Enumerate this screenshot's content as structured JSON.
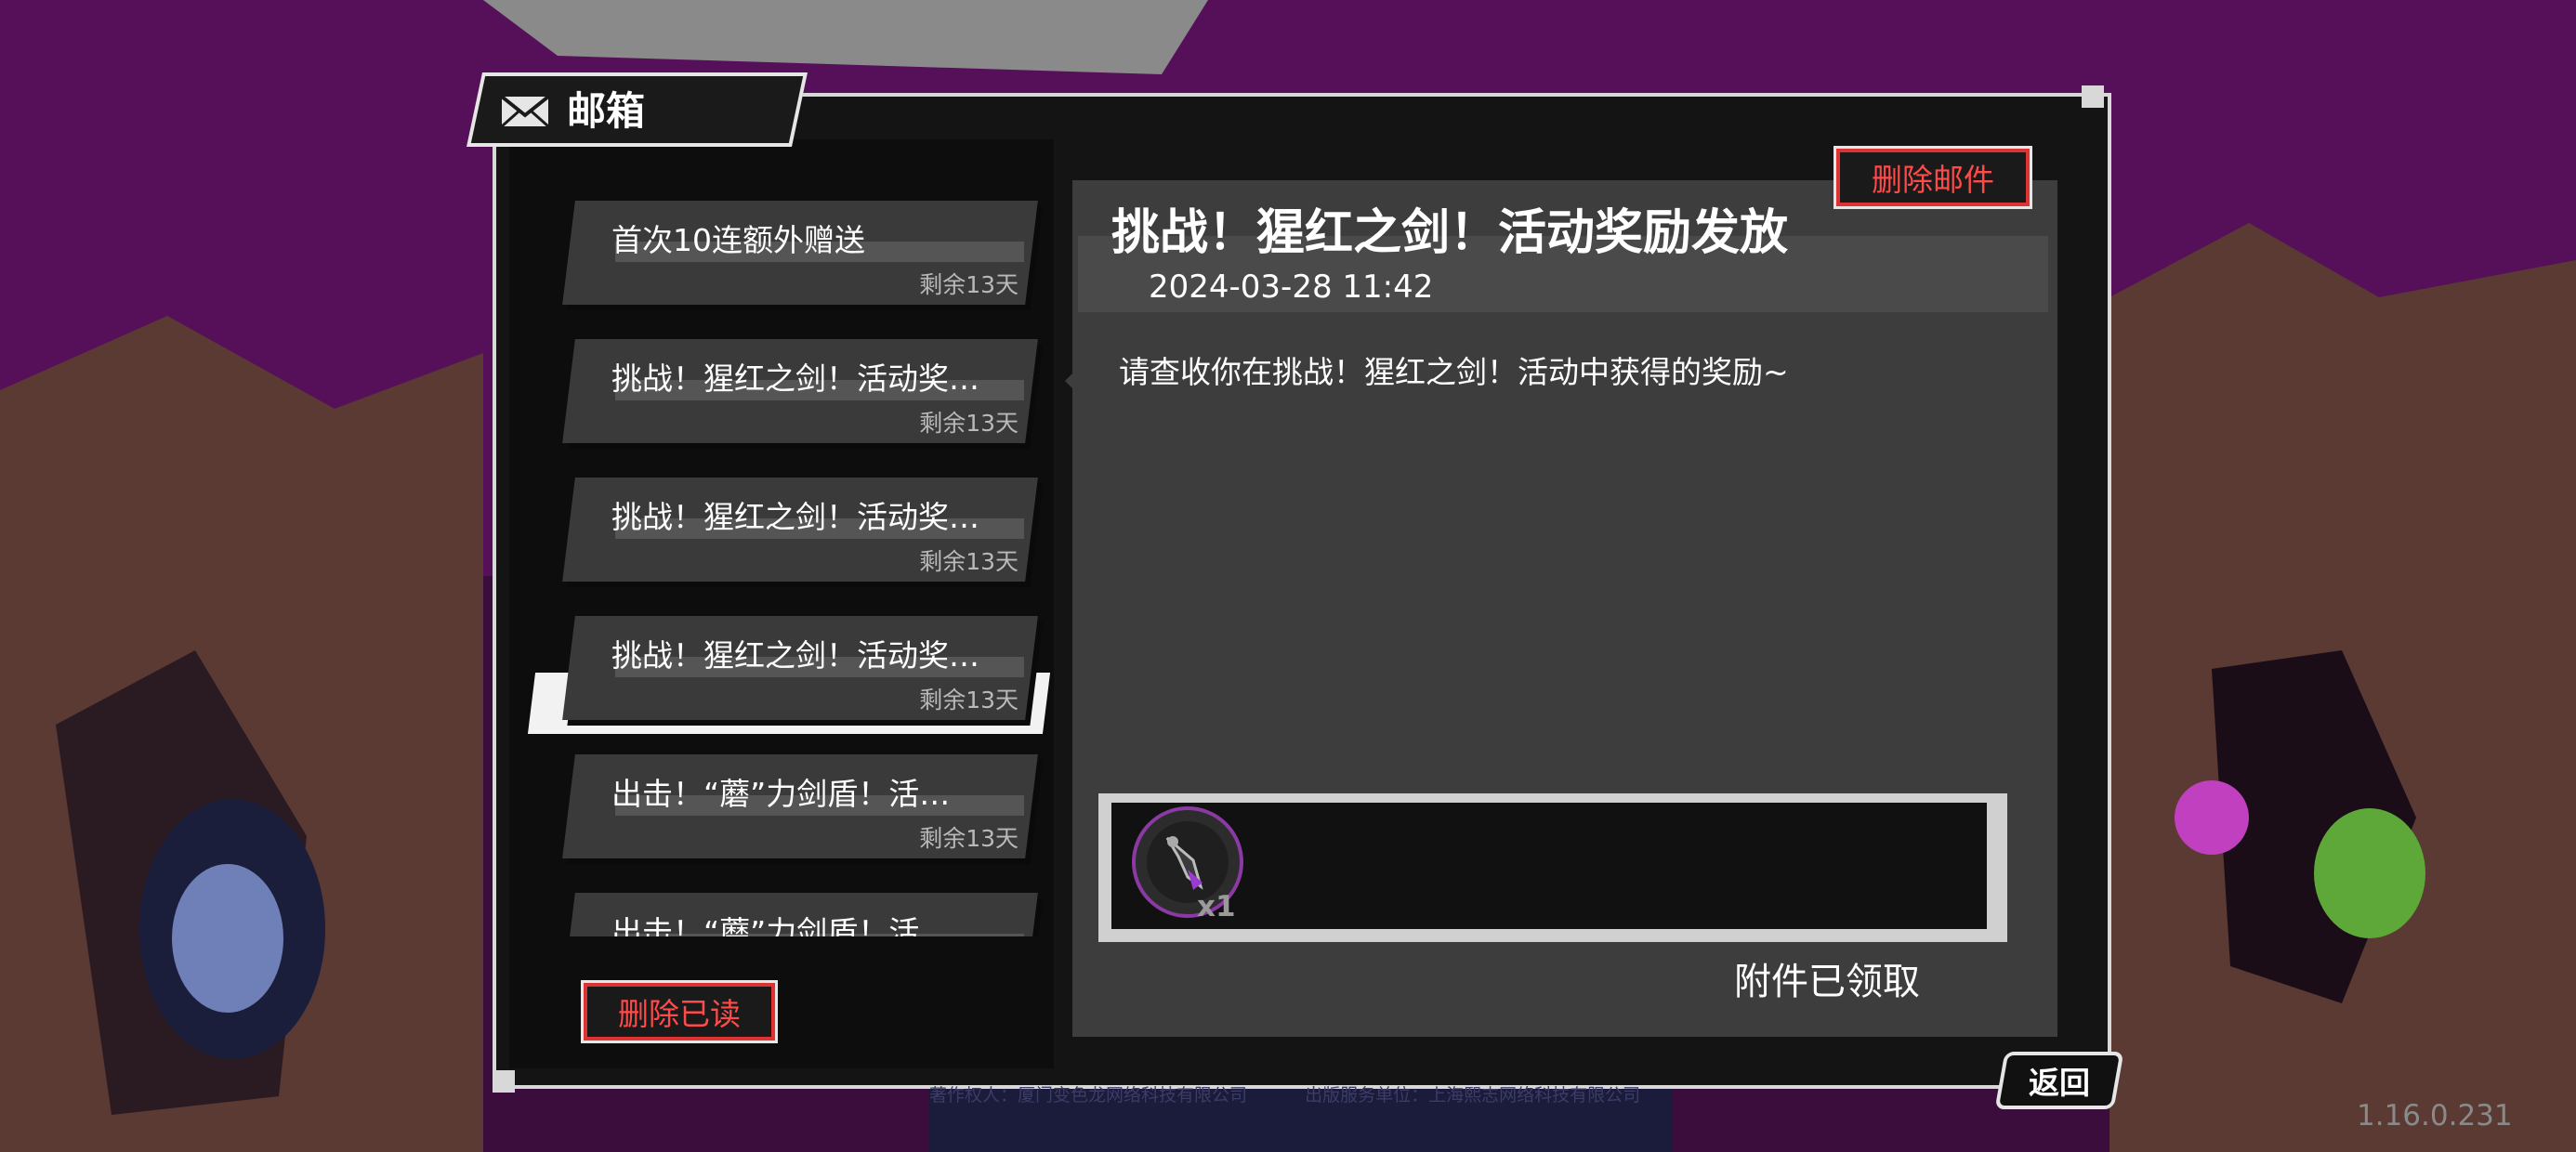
{
  "window": {
    "title": "邮箱"
  },
  "mail_list": [
    {
      "title": "首次10连额外赠送",
      "remaining": "剩余13天",
      "selected": false
    },
    {
      "title": "挑战！猩红之剑！活动奖…",
      "remaining": "剩余13天",
      "selected": false
    },
    {
      "title": "挑战！猩红之剑！活动奖…",
      "remaining": "剩余13天",
      "selected": false
    },
    {
      "title": "挑战！猩红之剑！活动奖…",
      "remaining": "剩余13天",
      "selected": true
    },
    {
      "title": "出击！“蘑”力剑盾！活…",
      "remaining": "剩余13天",
      "selected": false
    },
    {
      "title": "出击！“蘑”力剑盾！活…",
      "remaining": "",
      "selected": false
    }
  ],
  "buttons": {
    "delete_mail": "删除邮件",
    "delete_read": "删除已读",
    "back": "返回"
  },
  "detail": {
    "title": "挑战！猩红之剑！活动奖励发放",
    "date": "2024-03-28 11:42",
    "body": "请查收你在挑战！猩红之剑！活动中获得的奖励~",
    "attachment": {
      "icon": "sword-item-icon",
      "count": "x1"
    },
    "attachment_status": "附件已领取"
  },
  "footer": {
    "copyright": "著作权人：厦门变色龙网络科技有限公司",
    "publisher": "出版服务单位：上海熙志网络科技有限公司"
  },
  "version": "1.16.0.231",
  "colors": {
    "accent_red": "#ff4a4a",
    "panel": "#141414",
    "card": "#3a3a3a",
    "bg": "#2a0a2a"
  }
}
